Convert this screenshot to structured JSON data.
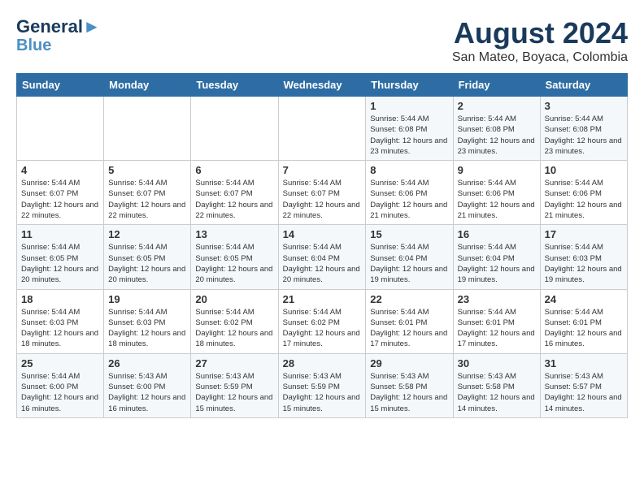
{
  "header": {
    "logo_line1": "General",
    "logo_line2": "Blue",
    "month_title": "August 2024",
    "subtitle": "San Mateo, Boyaca, Colombia"
  },
  "weekdays": [
    "Sunday",
    "Monday",
    "Tuesday",
    "Wednesday",
    "Thursday",
    "Friday",
    "Saturday"
  ],
  "weeks": [
    [
      {
        "day": "",
        "sunrise": "",
        "sunset": "",
        "daylight": ""
      },
      {
        "day": "",
        "sunrise": "",
        "sunset": "",
        "daylight": ""
      },
      {
        "day": "",
        "sunrise": "",
        "sunset": "",
        "daylight": ""
      },
      {
        "day": "",
        "sunrise": "",
        "sunset": "",
        "daylight": ""
      },
      {
        "day": "1",
        "sunrise": "Sunrise: 5:44 AM",
        "sunset": "Sunset: 6:08 PM",
        "daylight": "Daylight: 12 hours and 23 minutes."
      },
      {
        "day": "2",
        "sunrise": "Sunrise: 5:44 AM",
        "sunset": "Sunset: 6:08 PM",
        "daylight": "Daylight: 12 hours and 23 minutes."
      },
      {
        "day": "3",
        "sunrise": "Sunrise: 5:44 AM",
        "sunset": "Sunset: 6:08 PM",
        "daylight": "Daylight: 12 hours and 23 minutes."
      }
    ],
    [
      {
        "day": "4",
        "sunrise": "Sunrise: 5:44 AM",
        "sunset": "Sunset: 6:07 PM",
        "daylight": "Daylight: 12 hours and 22 minutes."
      },
      {
        "day": "5",
        "sunrise": "Sunrise: 5:44 AM",
        "sunset": "Sunset: 6:07 PM",
        "daylight": "Daylight: 12 hours and 22 minutes."
      },
      {
        "day": "6",
        "sunrise": "Sunrise: 5:44 AM",
        "sunset": "Sunset: 6:07 PM",
        "daylight": "Daylight: 12 hours and 22 minutes."
      },
      {
        "day": "7",
        "sunrise": "Sunrise: 5:44 AM",
        "sunset": "Sunset: 6:07 PM",
        "daylight": "Daylight: 12 hours and 22 minutes."
      },
      {
        "day": "8",
        "sunrise": "Sunrise: 5:44 AM",
        "sunset": "Sunset: 6:06 PM",
        "daylight": "Daylight: 12 hours and 21 minutes."
      },
      {
        "day": "9",
        "sunrise": "Sunrise: 5:44 AM",
        "sunset": "Sunset: 6:06 PM",
        "daylight": "Daylight: 12 hours and 21 minutes."
      },
      {
        "day": "10",
        "sunrise": "Sunrise: 5:44 AM",
        "sunset": "Sunset: 6:06 PM",
        "daylight": "Daylight: 12 hours and 21 minutes."
      }
    ],
    [
      {
        "day": "11",
        "sunrise": "Sunrise: 5:44 AM",
        "sunset": "Sunset: 6:05 PM",
        "daylight": "Daylight: 12 hours and 20 minutes."
      },
      {
        "day": "12",
        "sunrise": "Sunrise: 5:44 AM",
        "sunset": "Sunset: 6:05 PM",
        "daylight": "Daylight: 12 hours and 20 minutes."
      },
      {
        "day": "13",
        "sunrise": "Sunrise: 5:44 AM",
        "sunset": "Sunset: 6:05 PM",
        "daylight": "Daylight: 12 hours and 20 minutes."
      },
      {
        "day": "14",
        "sunrise": "Sunrise: 5:44 AM",
        "sunset": "Sunset: 6:04 PM",
        "daylight": "Daylight: 12 hours and 20 minutes."
      },
      {
        "day": "15",
        "sunrise": "Sunrise: 5:44 AM",
        "sunset": "Sunset: 6:04 PM",
        "daylight": "Daylight: 12 hours and 19 minutes."
      },
      {
        "day": "16",
        "sunrise": "Sunrise: 5:44 AM",
        "sunset": "Sunset: 6:04 PM",
        "daylight": "Daylight: 12 hours and 19 minutes."
      },
      {
        "day": "17",
        "sunrise": "Sunrise: 5:44 AM",
        "sunset": "Sunset: 6:03 PM",
        "daylight": "Daylight: 12 hours and 19 minutes."
      }
    ],
    [
      {
        "day": "18",
        "sunrise": "Sunrise: 5:44 AM",
        "sunset": "Sunset: 6:03 PM",
        "daylight": "Daylight: 12 hours and 18 minutes."
      },
      {
        "day": "19",
        "sunrise": "Sunrise: 5:44 AM",
        "sunset": "Sunset: 6:03 PM",
        "daylight": "Daylight: 12 hours and 18 minutes."
      },
      {
        "day": "20",
        "sunrise": "Sunrise: 5:44 AM",
        "sunset": "Sunset: 6:02 PM",
        "daylight": "Daylight: 12 hours and 18 minutes."
      },
      {
        "day": "21",
        "sunrise": "Sunrise: 5:44 AM",
        "sunset": "Sunset: 6:02 PM",
        "daylight": "Daylight: 12 hours and 17 minutes."
      },
      {
        "day": "22",
        "sunrise": "Sunrise: 5:44 AM",
        "sunset": "Sunset: 6:01 PM",
        "daylight": "Daylight: 12 hours and 17 minutes."
      },
      {
        "day": "23",
        "sunrise": "Sunrise: 5:44 AM",
        "sunset": "Sunset: 6:01 PM",
        "daylight": "Daylight: 12 hours and 17 minutes."
      },
      {
        "day": "24",
        "sunrise": "Sunrise: 5:44 AM",
        "sunset": "Sunset: 6:01 PM",
        "daylight": "Daylight: 12 hours and 16 minutes."
      }
    ],
    [
      {
        "day": "25",
        "sunrise": "Sunrise: 5:44 AM",
        "sunset": "Sunset: 6:00 PM",
        "daylight": "Daylight: 12 hours and 16 minutes."
      },
      {
        "day": "26",
        "sunrise": "Sunrise: 5:43 AM",
        "sunset": "Sunset: 6:00 PM",
        "daylight": "Daylight: 12 hours and 16 minutes."
      },
      {
        "day": "27",
        "sunrise": "Sunrise: 5:43 AM",
        "sunset": "Sunset: 5:59 PM",
        "daylight": "Daylight: 12 hours and 15 minutes."
      },
      {
        "day": "28",
        "sunrise": "Sunrise: 5:43 AM",
        "sunset": "Sunset: 5:59 PM",
        "daylight": "Daylight: 12 hours and 15 minutes."
      },
      {
        "day": "29",
        "sunrise": "Sunrise: 5:43 AM",
        "sunset": "Sunset: 5:58 PM",
        "daylight": "Daylight: 12 hours and 15 minutes."
      },
      {
        "day": "30",
        "sunrise": "Sunrise: 5:43 AM",
        "sunset": "Sunset: 5:58 PM",
        "daylight": "Daylight: 12 hours and 14 minutes."
      },
      {
        "day": "31",
        "sunrise": "Sunrise: 5:43 AM",
        "sunset": "Sunset: 5:57 PM",
        "daylight": "Daylight: 12 hours and 14 minutes."
      }
    ]
  ]
}
